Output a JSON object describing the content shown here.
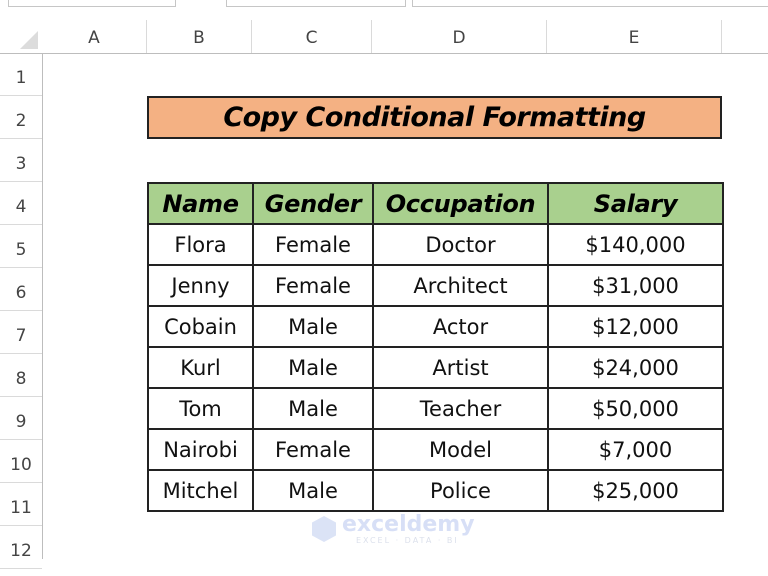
{
  "spreadsheet": {
    "column_headers": [
      "A",
      "B",
      "C",
      "D",
      "E"
    ],
    "row_headers": [
      "1",
      "2",
      "3",
      "4",
      "5",
      "6",
      "7",
      "8",
      "9",
      "10",
      "11",
      "12"
    ],
    "title": "Copy Conditional Formatting",
    "title_fill_color": "#f4b183",
    "header_fill_color": "#a9d08e",
    "table": {
      "headers": [
        "Name",
        "Gender",
        "Occupation",
        "Salary"
      ],
      "rows": [
        [
          "Flora",
          "Female",
          "Doctor",
          "$140,000"
        ],
        [
          "Jenny",
          "Female",
          "Architect",
          "$31,000"
        ],
        [
          "Cobain",
          "Male",
          "Actor",
          "$12,000"
        ],
        [
          "Kurl",
          "Male",
          "Artist",
          "$24,000"
        ],
        [
          "Tom",
          "Male",
          "Teacher",
          "$50,000"
        ],
        [
          "Nairobi",
          "Female",
          "Model",
          "$7,000"
        ],
        [
          "Mitchel",
          "Male",
          "Police",
          "$25,000"
        ]
      ]
    }
  },
  "watermark": {
    "name": "exceldemy",
    "tagline": "EXCEL · DATA · BI"
  }
}
